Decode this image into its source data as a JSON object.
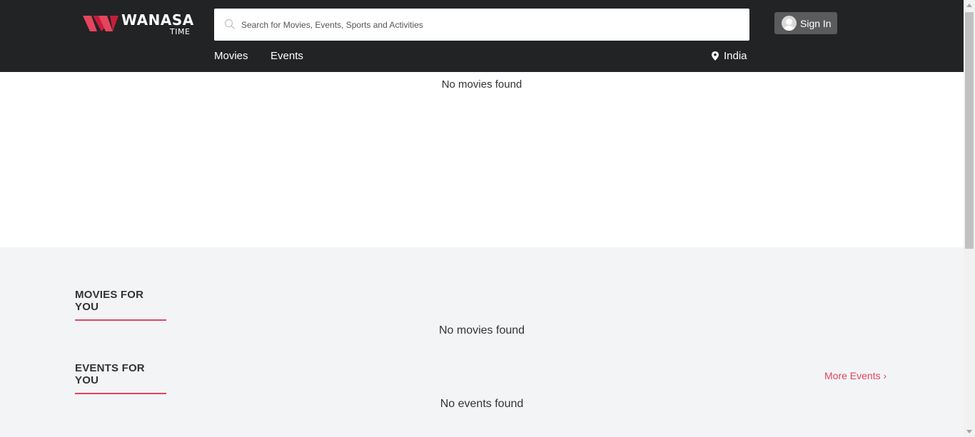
{
  "brand": {
    "name": "WANASA",
    "sub": "TIME",
    "accent": "#e5455d"
  },
  "search": {
    "placeholder": "Search for Movies, Events, Sports and Activities",
    "value": ""
  },
  "header": {
    "signin_label": "Sign In",
    "location": "India"
  },
  "nav": {
    "items": [
      {
        "label": "Movies"
      },
      {
        "label": "Events"
      }
    ]
  },
  "main": {
    "top_message": "No movies found"
  },
  "sections": {
    "movies": {
      "title": "MOVIES FOR YOU",
      "empty": "No movies found"
    },
    "events": {
      "title": "EVENTS FOR YOU",
      "empty": "No events found",
      "more_label": "More Events ›"
    }
  },
  "icons": {
    "search": "search-icon",
    "user": "user-avatar-icon",
    "location": "map-pin-icon"
  }
}
